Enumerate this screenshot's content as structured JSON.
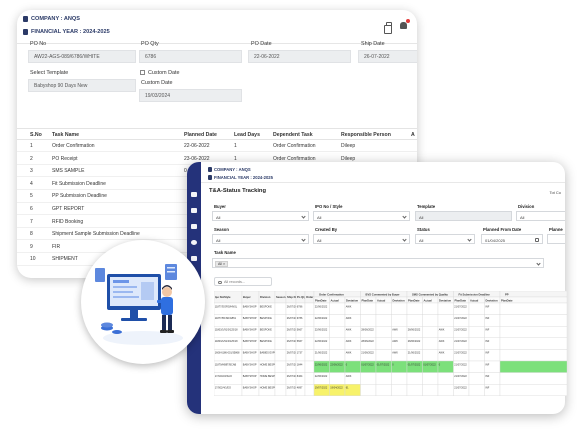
{
  "back_card": {
    "company": "COMPANY : ANQS",
    "financial_year": "FINANCIAL YEAR : 2024-2025",
    "fields": {
      "po_no": {
        "label": "PO No",
        "value": "AW22-AGS-089/6786/WHITE"
      },
      "po_qty": {
        "label": "PO Qty",
        "value": "6786"
      },
      "po_date": {
        "label": "PO Date",
        "value": "22-06-2022"
      },
      "ship_date": {
        "label": "Ship Date",
        "value": "26-07-2022"
      },
      "select_template": {
        "label": "Select Template",
        "value": "Babyshop 90 Days New"
      },
      "custom_date_check": {
        "label": "Custom Date"
      },
      "custom_date": {
        "label": "Custom Date",
        "value": "19/03/2024"
      }
    },
    "table": {
      "headers": [
        "S.No",
        "Task Name",
        "Planned Date",
        "Lead Days",
        "Dependent Task",
        "Responsible Person",
        "A"
      ],
      "rows": [
        [
          "1",
          "Order Confirmation",
          "22-06-2022",
          "1",
          "Order Confirmation",
          "Dileep"
        ],
        [
          "2",
          "PO Receipt",
          "23-06-2022",
          "1",
          "Order Confirmation",
          "Dileep"
        ],
        [
          "3",
          "SMS SAMPLE",
          "0",
          "",
          "",
          ""
        ],
        [
          "4",
          "Fit Submission Deadline",
          "",
          "",
          "",
          ""
        ],
        [
          "5",
          "PP Submission Deadline",
          "",
          "",
          "",
          ""
        ],
        [
          "6",
          "GPT REPORT",
          "",
          "",
          "",
          ""
        ],
        [
          "7",
          "RFID Booking",
          "",
          "",
          "",
          ""
        ],
        [
          "8",
          "Shipment Sample Submission Deadline",
          "",
          "",
          "",
          ""
        ],
        [
          "9",
          "FIR",
          "",
          "",
          "",
          ""
        ],
        [
          "10",
          "SHIPMENT",
          "",
          "",
          "",
          ""
        ]
      ]
    }
  },
  "front_card": {
    "company": "COMPANY : ANQS",
    "financial_year": "FINANCIAL YEAR : 2024-2025",
    "title": "T&A-Status Tracking",
    "stub": "Tot Co",
    "filters": {
      "buyer": {
        "label": "Buyer",
        "value": "All"
      },
      "po_style": {
        "label": "IPO No / Style",
        "value": "All"
      },
      "template": {
        "label": "Template",
        "value": "All"
      },
      "division": {
        "label": "Division",
        "value": "All"
      },
      "season": {
        "label": "Season",
        "value": "All"
      },
      "created_by": {
        "label": "Created By",
        "value": "All"
      },
      "status": {
        "label": "Status",
        "value": "All"
      },
      "planned_from": {
        "label": "Planned From Date",
        "value": "01/04/2025"
      },
      "planned_to": {
        "label": "Planne",
        "value": ""
      },
      "task_name": {
        "label": "Task Name",
        "tag": "All"
      }
    },
    "search_placeholder": "All records...",
    "grid": {
      "fixed_headers": [
        "Ipo No/Style",
        "Buyer",
        "Division",
        "Season",
        "Ship Date",
        "Po Qty",
        "Order Qty"
      ],
      "group_headers": [
        "Order Confirmation",
        "BVS Commented by Buyer",
        "SMS Commented by Quality",
        "Fit Submission Deadline",
        "PP"
      ],
      "sub_headers": [
        "PlanDate",
        "Actual",
        "Deviation"
      ],
      "rows": [
        {
          "ipo": "11877/DORO/HNSL",
          "buyer": "BABYSHOP",
          "div": "BESPOKE",
          "season": "",
          "ship": "26/07/2022",
          "poqty": "6786",
          "oq": "",
          "oc": [
            "22/06/2022",
            "",
            "AWK"
          ],
          "bvs": [
            "",
            "",
            ""
          ],
          "sms": [
            "",
            "",
            ""
          ],
          "fit": [
            "21/07/2022",
            "",
            "INF"
          ],
          "pp": "",
          "hl": ""
        },
        {
          "ipo": "11877/BCSD/AB51",
          "buyer": "BABYSHOP",
          "div": "BESPOKE",
          "season": "",
          "ship": "26/07/2022",
          "poqty": "6786",
          "oq": "",
          "oc": [
            "22/06/2022",
            "",
            "AWK"
          ],
          "bvs": [
            "",
            "",
            ""
          ],
          "sms": [
            "",
            "",
            ""
          ],
          "fit": [
            "21/07/2022",
            "",
            "INF"
          ],
          "pp": "",
          "hl": ""
        },
        {
          "ipo": "11803/1/91/0/125/18",
          "buyer": "BABYSHOP",
          "div": "BESPOKE",
          "season": "",
          "ship": "26/07/2022",
          "poqty": "5667",
          "oq": "",
          "oc": [
            "22/06/2022",
            "",
            "AWK"
          ],
          "bvs": [
            "28/06/2022",
            "",
            "AWK"
          ],
          "sms": [
            "28/06/2022",
            "",
            "AWK"
          ],
          "fit": [
            "21/07/2022",
            "",
            "INF"
          ],
          "pp": "",
          "hl": ""
        },
        {
          "ipo": "11803/1/91/0/125/18",
          "buyer": "BABYSHOP",
          "div": "BESPOKE",
          "season": "",
          "ship": "26/07/2022",
          "poqty": "5667",
          "oq": "",
          "oc": [
            "22/06/2022",
            "",
            "AWK"
          ],
          "bvs": [
            "28/06/2022",
            "",
            "AWK"
          ],
          "sms": [
            "28/06/2022",
            "",
            "AWK"
          ],
          "fit": [
            "21/07/2022",
            "",
            "INF"
          ],
          "pp": "",
          "hl": ""
        },
        {
          "ipo": "1608-6186-001/35868",
          "buyer": "BABYSHOP",
          "div": "BABIES EXPORTS",
          "season": "",
          "ship": "26/07/2022",
          "poqty": "1737",
          "oq": "",
          "oc": [
            "21/06/2022",
            "",
            "AWK"
          ],
          "bvs": [
            "21/06/2022",
            "",
            "AWK"
          ],
          "sms": [
            "21/06/2022",
            "",
            "AWK"
          ],
          "fit": [
            "21/07/2022",
            "",
            "INF"
          ],
          "pp": "",
          "hl": ""
        },
        {
          "ipo": "11879/HB9T/BCAB",
          "buyer": "BABYSHOP",
          "div": "HOME BESPOKE",
          "season": "",
          "ship": "26/07/2022",
          "poqty": "1844",
          "oq": "",
          "oc": [
            "22/06/2022",
            "22/06/2022",
            "0"
          ],
          "bvs": [
            "01/07/2022",
            "01/07/2022",
            "0"
          ],
          "sms": [
            "01/07/2022",
            "01/07/2022",
            "0"
          ],
          "fit": [
            "21/07/2022",
            "",
            "INF"
          ],
          "pp": "",
          "hl": "green"
        },
        {
          "ipo": "17/1002/4/SAO",
          "buyer": "BABYSHOP",
          "div": "HOME BESPOKE",
          "season": "",
          "ship": "26/07/2022",
          "poqty": "8464",
          "oq": "",
          "oc": [
            "22/06/2022",
            "",
            "AWK"
          ],
          "bvs": [
            "",
            "",
            ""
          ],
          "sms": [
            "",
            "",
            ""
          ],
          "fit": [
            "21/07/2022",
            "",
            "INF"
          ],
          "pp": "",
          "hl": ""
        },
        {
          "ipo": "17/002/4/1/EO",
          "buyer": "BABYSHOP",
          "div": "HOME BESPOKE",
          "season": "",
          "ship": "26/07/2022",
          "poqty": "4897",
          "oq": "",
          "oc": [
            "19/07/2022",
            "19/04/2022",
            "61"
          ],
          "bvs": [
            "",
            "",
            ""
          ],
          "sms": [
            "",
            "",
            ""
          ],
          "fit": [
            "21/07/2022",
            "",
            "INF"
          ],
          "pp": "",
          "hl": "yellow"
        }
      ]
    }
  },
  "colors": {
    "sidebar": "#24327a",
    "title_text": "#2b3a67",
    "highlight_green": "#7ce07b",
    "highlight_yellow": "#f7f26a",
    "bell_badge": "#e23b3b"
  }
}
